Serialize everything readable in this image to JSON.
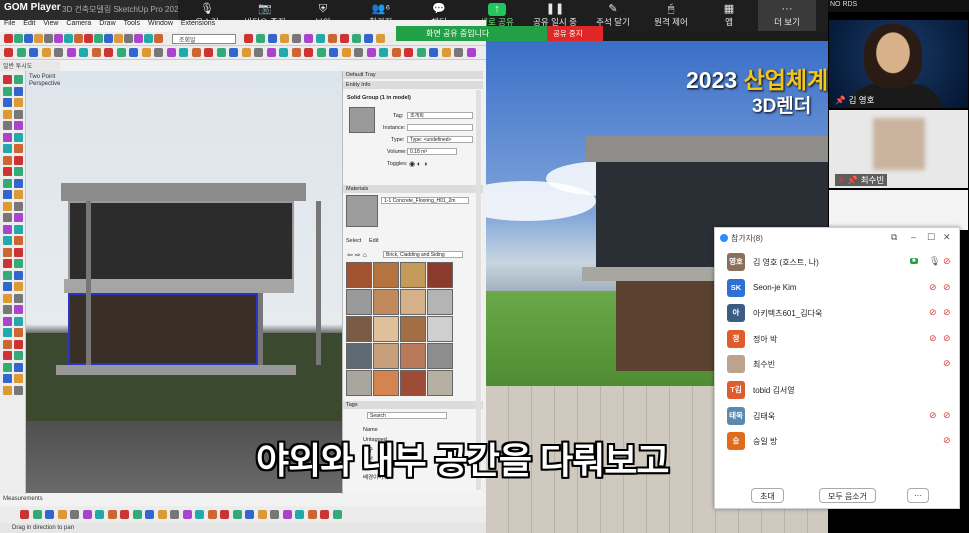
{
  "gom": {
    "logo": "GOM Player",
    "file": "3D 건축모델링 SketchUp Pro 2021"
  },
  "zoom_toolbar": [
    {
      "icon": "mic-icon",
      "glyph": "🎙",
      "label": "음소거",
      "green": false
    },
    {
      "icon": "video-off-icon",
      "glyph": "📷",
      "label": "비디오 중지",
      "green": false
    },
    {
      "icon": "shield-icon",
      "glyph": "⛨",
      "label": "보안",
      "green": false
    },
    {
      "icon": "participants-icon",
      "glyph": "👥⁶",
      "label": "참가자",
      "green": false
    },
    {
      "icon": "chat-icon",
      "glyph": "💬",
      "label": "채팅",
      "green": false
    },
    {
      "icon": "share-screen-icon",
      "glyph": "↑",
      "label": "새로 공유",
      "green": true
    },
    {
      "icon": "pause-share-icon",
      "glyph": "❚❚",
      "label": "공유 일시 중",
      "green": false
    },
    {
      "icon": "annotate-icon",
      "glyph": "✎",
      "label": "주석 달기",
      "green": false
    },
    {
      "icon": "remote-control-icon",
      "glyph": "🖱",
      "label": "원격 제어",
      "green": false
    },
    {
      "icon": "apps-icon",
      "glyph": "▦",
      "label": "앱",
      "green": false
    },
    {
      "icon": "more-icon",
      "glyph": "···",
      "label": "더 보기",
      "green": false
    }
  ],
  "zoom_ext": "NO RDS",
  "share_banner": {
    "text": "화면 공유 중입니다",
    "stop": "공유 중지"
  },
  "sketchup": {
    "menu": [
      "File",
      "Edit",
      "View",
      "Camera",
      "Draw",
      "Tools",
      "Window",
      "Extensions"
    ],
    "style_select": "조회일",
    "tab": "일반 투시도",
    "viewport_label": "Two Point\nPerspective",
    "tray": {
      "title": "Default Tray",
      "entity_info": "Entity Info",
      "solid_group": "Solid Group (1 in model)",
      "tag_label": "Tag:",
      "tag_value": "조개회",
      "instance_label": "Instance:",
      "type_label": "Type:",
      "type_value": "Type: <undefined>",
      "volume_label": "Volume:",
      "volume_value": "0.18 m³",
      "toggles_label": "Toggles:",
      "materials": "Materials",
      "material_name": "1-1 Concrete_Flooring_H01_2m",
      "select_tab": "Select",
      "edit_tab": "Edit",
      "collection": "Brick, Cladding and Siding",
      "tags": "Tags",
      "search_placeholder": "Search",
      "tags_name": "Name",
      "tag_rows": [
        "Untagged",
        "가구",
        "계단",
        "벽",
        "배경이미지"
      ]
    },
    "measurements": "Measurements",
    "status": "Drag in direction to pan"
  },
  "render": {
    "title_prefix": "2023 ",
    "title_main": "산업체계",
    "title2": "3D렌더"
  },
  "subtitle": "야외와 내부 공간을 다뤄보고",
  "videos": [
    {
      "name": "김 영호",
      "pin": "📌"
    },
    {
      "name": "최수빈",
      "pin": "📌"
    }
  ],
  "participants_panel": {
    "title": "참가자(8)",
    "rows": [
      {
        "avatar": "영호",
        "color": "#8a6f5c",
        "name": "김 영호 (호스트, 나)",
        "video": true,
        "mic": true
      },
      {
        "avatar": "SK",
        "color": "#2f6fd6",
        "name": "Seon-je Kim",
        "video": false,
        "mic": false
      },
      {
        "avatar": "아",
        "color": "#3b5d84",
        "name": "아키텍츠601_김다욱",
        "video": false,
        "mic": false
      },
      {
        "avatar": "정",
        "color": "#e05c2c",
        "name": "정아 박",
        "video": false,
        "mic": false
      },
      {
        "avatar": "",
        "color": "#bba38d",
        "name": "최수빈",
        "video": false,
        "mic": false
      },
      {
        "avatar": "T김",
        "color": "#e05c2c",
        "name": "tobid 김서영",
        "video": false,
        "mic": false
      },
      {
        "avatar": "태욱",
        "color": "#5b8ab0",
        "name": "김태욱",
        "video": false,
        "mic": false
      },
      {
        "avatar": "승",
        "color": "#e06b1c",
        "name": "승일 방",
        "video": false,
        "mic": false
      }
    ],
    "invite": "초대",
    "mute_all": "모두 음소거",
    "more": "···"
  },
  "colors": {
    "zoom_green": "#22a045",
    "stop_red": "#e02727",
    "select_blue": "#2a35c8"
  }
}
